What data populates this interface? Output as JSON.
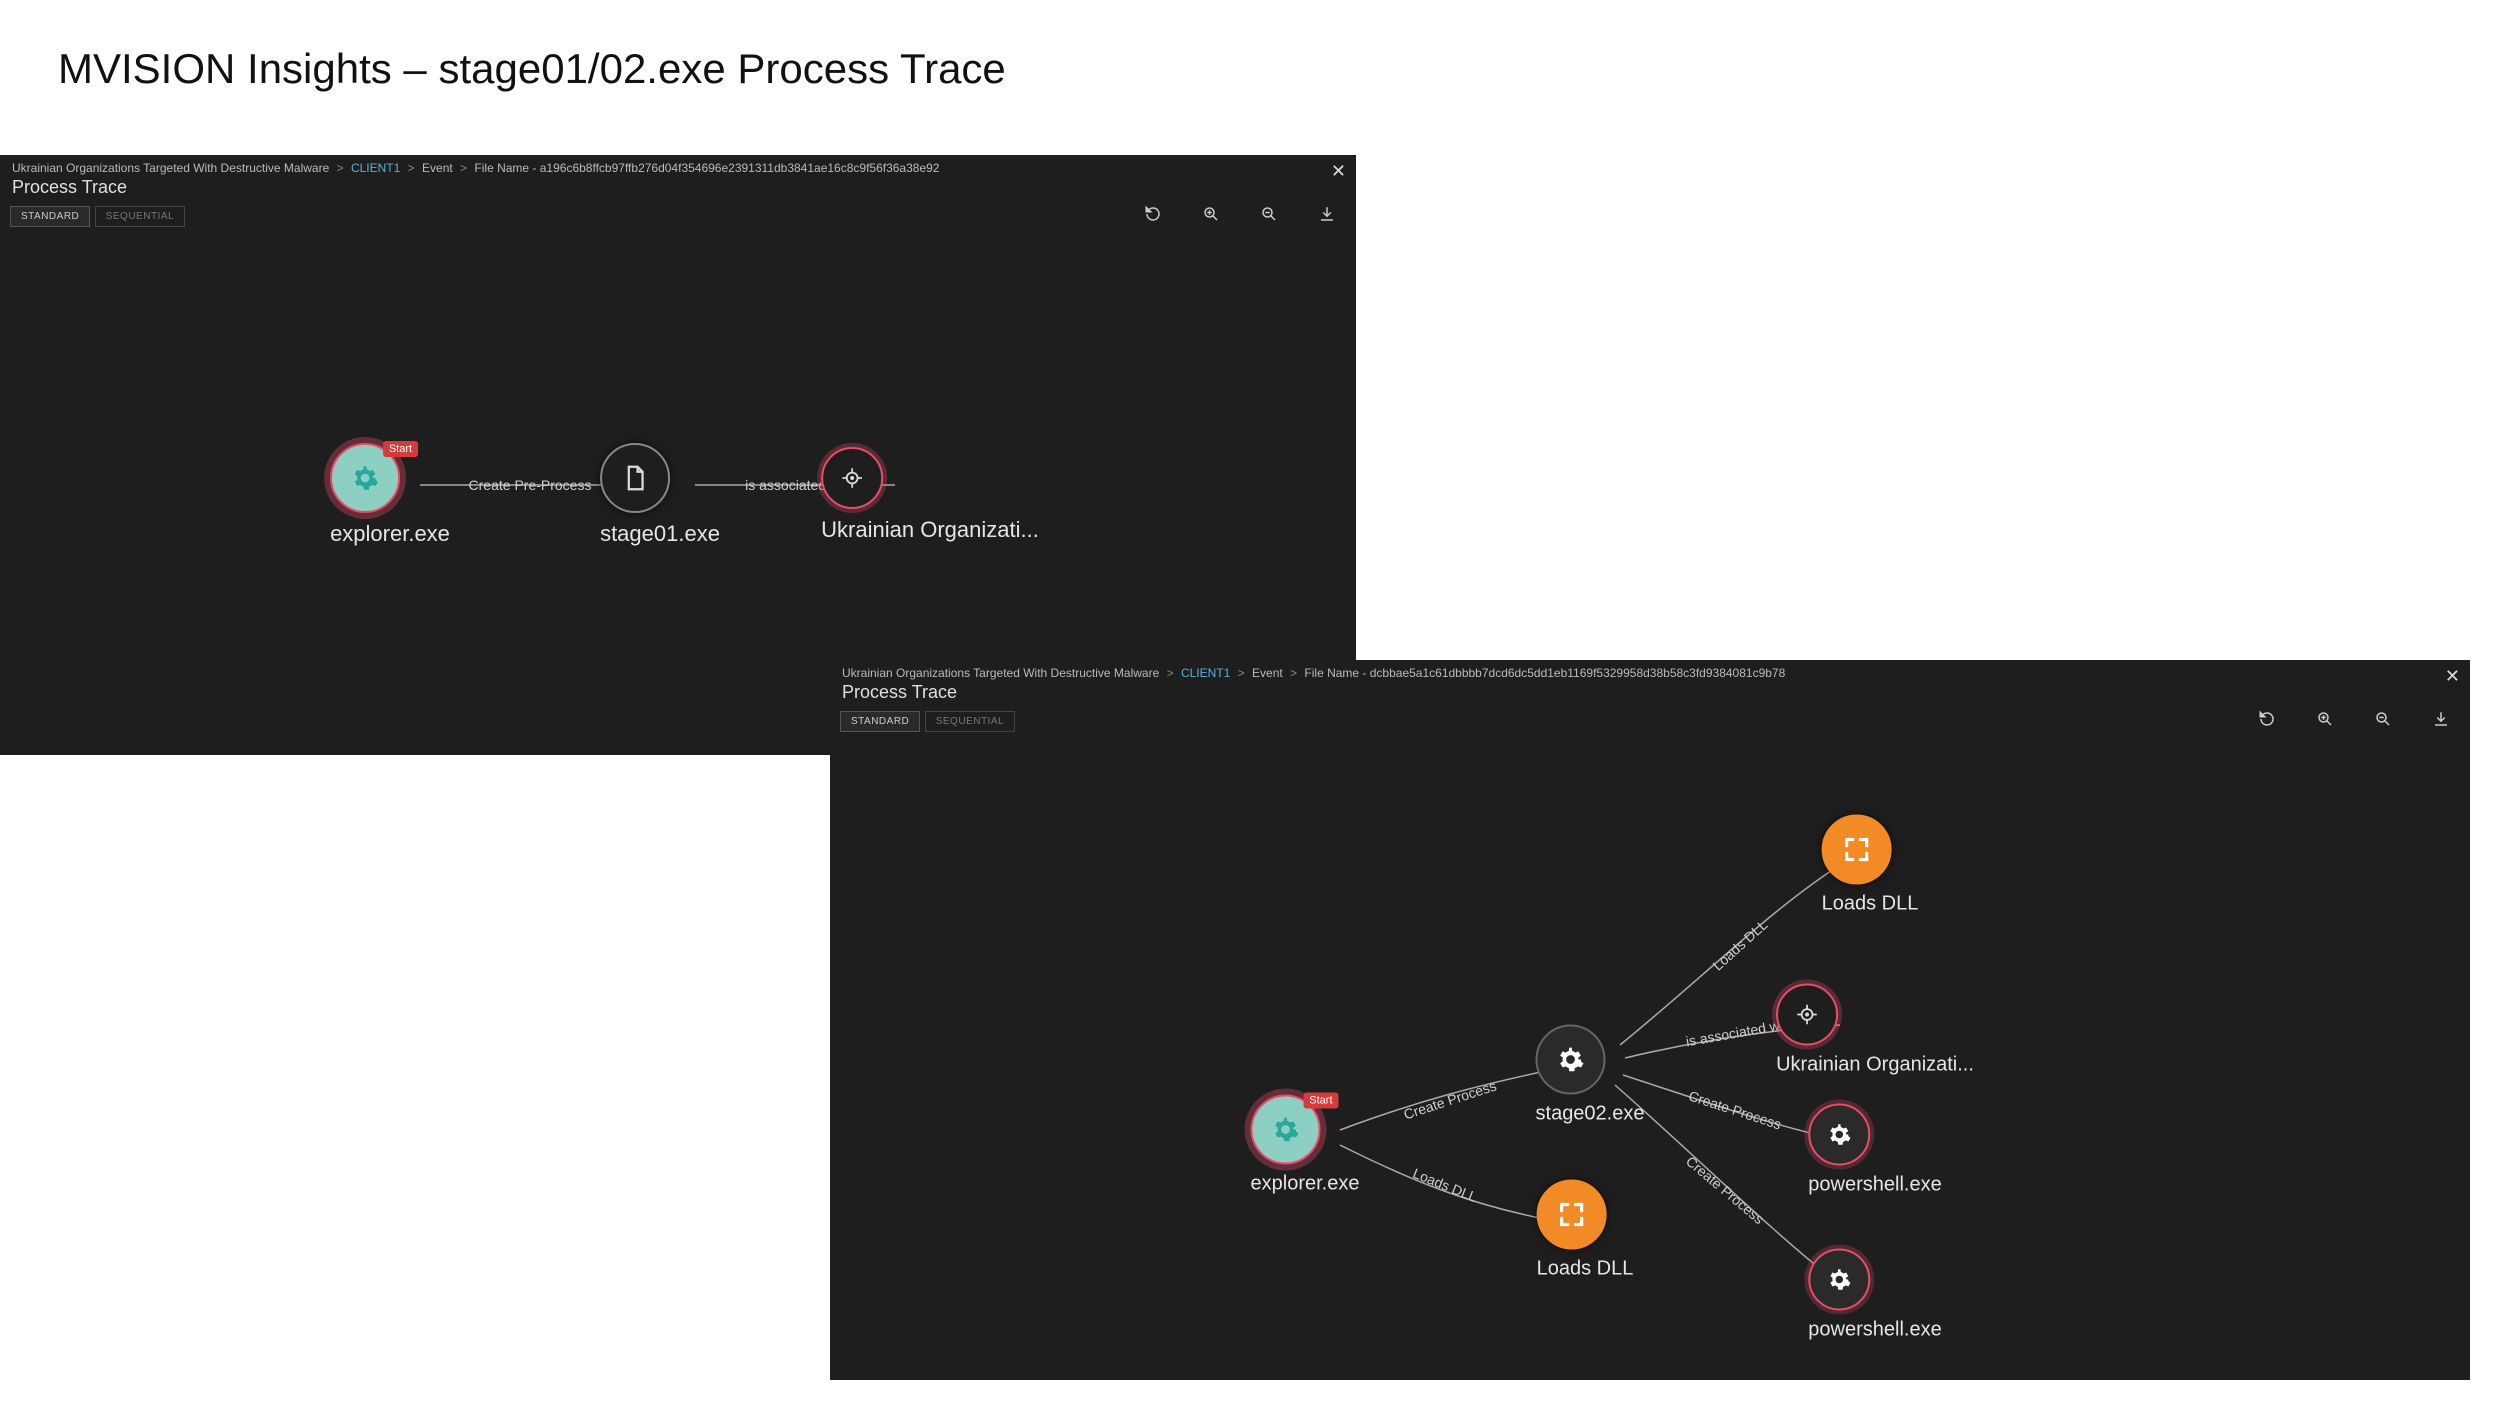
{
  "slide_title": "MVISION Insights – stage01/02.exe Process Trace",
  "panel1": {
    "breadcrumb": {
      "campaign": "Ukrainian Organizations Targeted With Destructive Malware",
      "client": "CLIENT1",
      "event": "Event",
      "file": "File Name - a196c6b8ffcb97ffb276d04f354696e2391311db3841ae16c8c9f56f36a38e92"
    },
    "title": "Process Trace",
    "tabs": {
      "standard": "STANDARD",
      "sequential": "SEQUENTIAL"
    },
    "toolbar": {
      "reset": "reset",
      "zoom_in": "zoom in",
      "zoom_out": "zoom out",
      "download": "download"
    },
    "nodes": {
      "explorer": {
        "label": "explorer.exe",
        "start_badge": "Start"
      },
      "stage01": {
        "label": "stage01.exe"
      },
      "campaign": {
        "label": "Ukrainian Organizati..."
      }
    },
    "edges": {
      "e1": "Create Pre-Process",
      "e2": "is associated with"
    }
  },
  "panel2": {
    "breadcrumb": {
      "campaign": "Ukrainian Organizations Targeted With Destructive Malware",
      "client": "CLIENT1",
      "event": "Event",
      "file": "File Name - dcbbae5a1c61dbbbb7dcd6dc5dd1eb1169f5329958d38b58c3fd9384081c9b78"
    },
    "title": "Process Trace",
    "tabs": {
      "standard": "STANDARD",
      "sequential": "SEQUENTIAL"
    },
    "toolbar": {
      "reset": "reset",
      "zoom_in": "zoom in",
      "zoom_out": "zoom out",
      "download": "download"
    },
    "nodes": {
      "explorer": {
        "label": "explorer.exe",
        "start_badge": "Start"
      },
      "stage02": {
        "label": "stage02.exe"
      },
      "dll_top": {
        "label": "Loads DLL"
      },
      "campaign": {
        "label": "Ukrainian Organizati..."
      },
      "ps1": {
        "label": "powershell.exe"
      },
      "ps2": {
        "label": "powershell.exe"
      },
      "dll_bottom": {
        "label": "Loads DLL"
      }
    },
    "edges": {
      "e_exp_stage": "Create Process",
      "e_exp_dllb": "Loads DLL",
      "e_stage_dllt": "Loads DLL",
      "e_stage_camp": "is associated with",
      "e_stage_ps1": "Create Process",
      "e_stage_ps2": "Create Process"
    }
  }
}
